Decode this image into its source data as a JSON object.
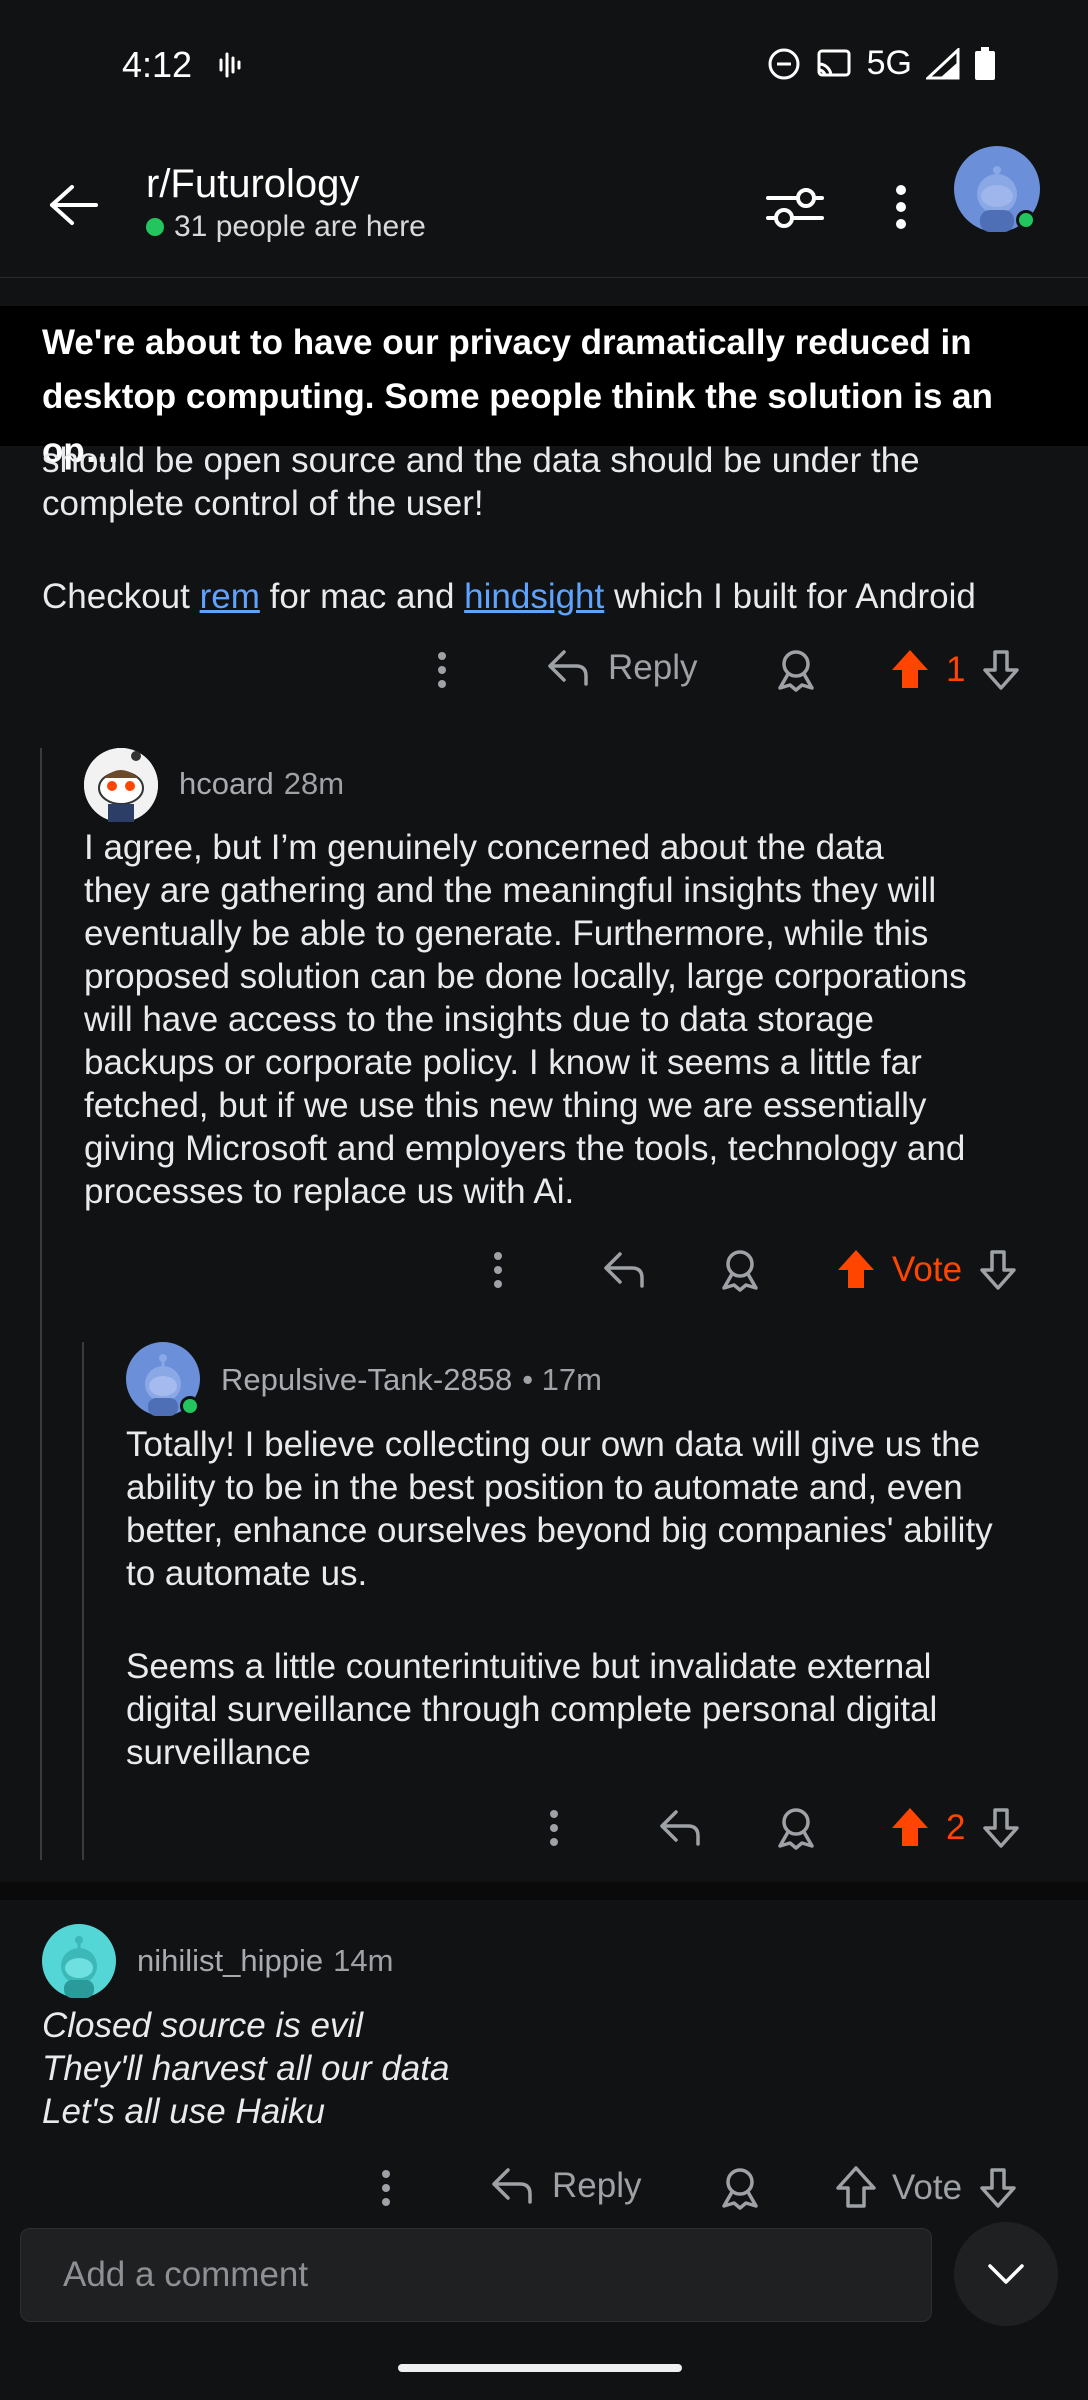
{
  "status_bar": {
    "time": "4:12",
    "network": "5G"
  },
  "header": {
    "subreddit": "r/Futurology",
    "online": "31 people are here"
  },
  "post": {
    "title": "We're about to have our privacy dramatically reduced in desktop computing. Some people think the solution is an op…"
  },
  "comment_top": {
    "line1": "should be open source and the data should be under the",
    "line2": "complete control of the user!",
    "checkout_prefix": "Checkout ",
    "link1": "rem",
    "middle": " for mac and ",
    "link2": "hindsight",
    "suffix": " which I built for Android",
    "reply_label": "Reply",
    "votes": "1"
  },
  "comment_hcoard": {
    "user": "hcoard",
    "time": "28m",
    "lines": [
      "I agree, but I’m genuinely concerned about the data",
      "they are gathering and the meaningful insights they will",
      "eventually be able to generate. Furthermore, while this",
      "proposed solution can be done locally, large corporations",
      "will have access to the insights due to data storage",
      "backups or corporate policy. I know it seems a little far",
      "fetched, but if we use this new thing we are essentially",
      "giving Microsoft and employers the tools, technology and",
      "processes to replace us with Ai."
    ],
    "vote_label": "Vote"
  },
  "comment_repulsive": {
    "user": "Repulsive-Tank-2858",
    "time": "• 17m",
    "para1": [
      "Totally! I believe collecting our own data will give us the",
      "ability to be in the best position to automate and, even",
      "better, enhance ourselves beyond big companies' ability",
      "to automate us."
    ],
    "para2": [
      "Seems a little counterintuitive but invalidate external",
      "digital surveillance through complete personal digital",
      "surveillance"
    ],
    "votes": "2"
  },
  "comment_nihilist": {
    "user": "nihilist_hippie",
    "time": "14m",
    "lines": [
      "Closed source is evil",
      "They'll harvest all our data",
      "Let's all use Haiku"
    ],
    "reply_label": "Reply",
    "vote_label": "Vote"
  },
  "comment_box": {
    "placeholder": "Add a comment"
  },
  "colors": {
    "upvote": "#ff4500",
    "link": "#5ea3ff",
    "online": "#22c55e"
  }
}
